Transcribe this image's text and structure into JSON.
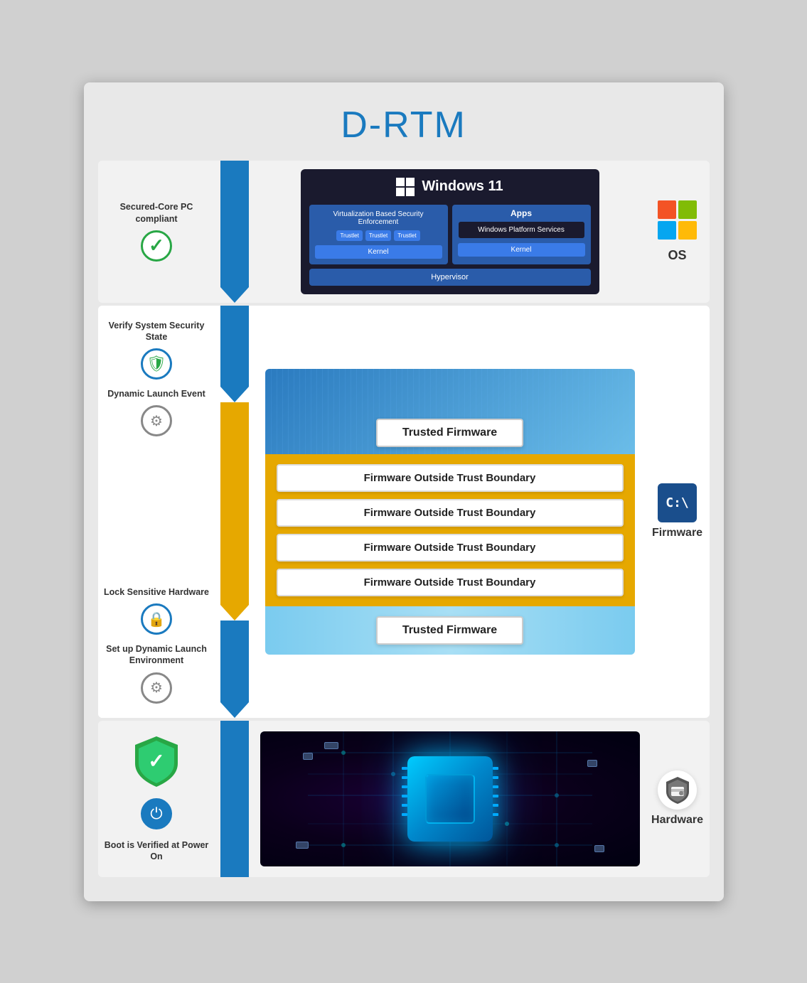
{
  "title": "D-RTM",
  "sections": {
    "os": {
      "label": "Secured-Core PC compliant",
      "windows_title": "Windows 11",
      "windows_components": {
        "vbs": "Virtualization Based Security Enforcement",
        "apps": "Apps",
        "windows_platform": "Windows Platform Services",
        "kernel1": "Kernel",
        "kernel2": "Kernel",
        "hypervisor": "Hypervisor"
      },
      "os_label": "OS"
    },
    "firmware": {
      "steps": [
        {
          "label": "Verify System Security State"
        },
        {
          "label": "Dynamic Launch Event"
        }
      ],
      "trusted_top": "Trusted Firmware",
      "outside_trust": [
        "Firmware Outside Trust Boundary",
        "Firmware Outside Trust Boundary",
        "Firmware Outside Trust Boundary",
        "Firmware Outside Trust Boundary"
      ],
      "trusted_bottom": "Trusted Firmware",
      "steps_bottom": [
        {
          "label": "Lock Sensitive Hardware"
        },
        {
          "label": "Set up Dynamic Launch Environment"
        }
      ],
      "firmware_label": "Firmware"
    },
    "hardware": {
      "label": "Boot is Verified at Power On",
      "hardware_label": "Hardware"
    }
  }
}
